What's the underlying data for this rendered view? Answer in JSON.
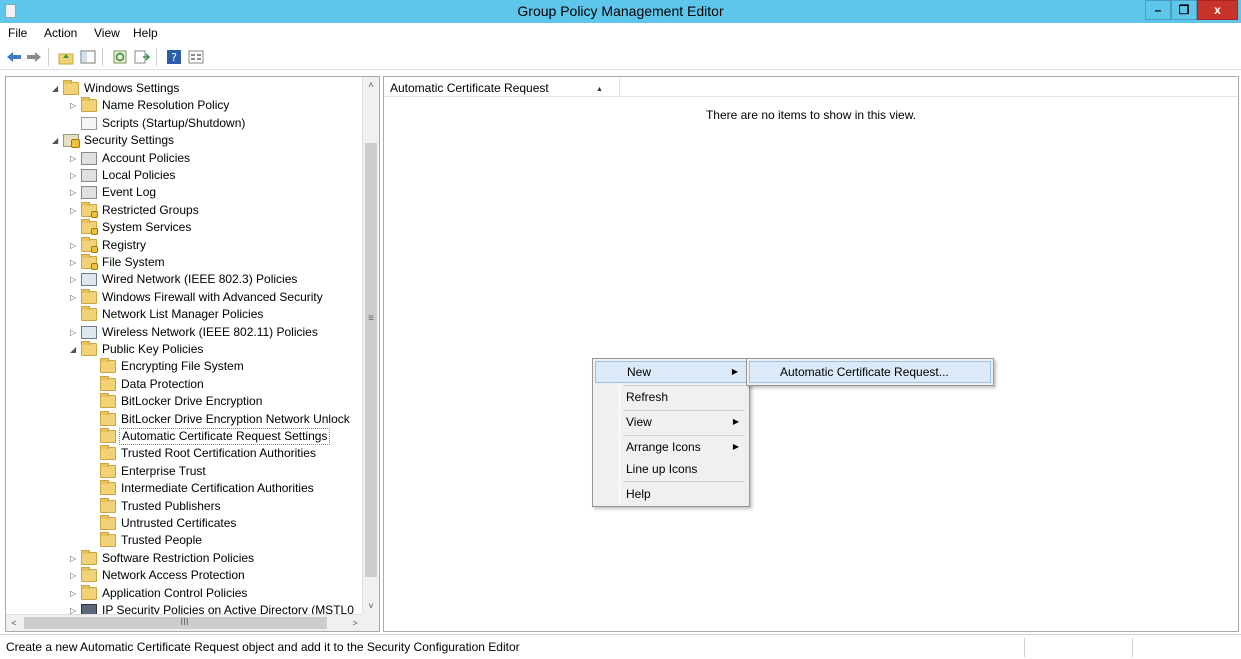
{
  "window": {
    "title": "Group Policy Management Editor",
    "min_glyph": "–",
    "max_glyph": "❐",
    "close_glyph": "x"
  },
  "menu": {
    "items": [
      "File",
      "Action",
      "View",
      "Help"
    ]
  },
  "colors": {
    "titlebar": "#5ec6eb",
    "close": "#c7352a",
    "highlight": "#dbe9f8",
    "folder": "#f2d277"
  },
  "tree": {
    "items": [
      {
        "label": "Windows Settings",
        "expander": "◢",
        "icon": "folder-icon"
      },
      {
        "label": "Name Resolution Policy",
        "expander": "▷",
        "icon": "folder-icon"
      },
      {
        "label": "Scripts (Startup/Shutdown)",
        "expander": "",
        "icon": "script-icon"
      },
      {
        "label": "Security Settings",
        "expander": "◢",
        "icon": "security-icon"
      },
      {
        "label": "Account Policies",
        "expander": "▷",
        "icon": "policy-icon"
      },
      {
        "label": "Local Policies",
        "expander": "▷",
        "icon": "policy-icon"
      },
      {
        "label": "Event Log",
        "expander": "▷",
        "icon": "policy-icon"
      },
      {
        "label": "Restricted Groups",
        "expander": "▷",
        "icon": "secure-folder-icon"
      },
      {
        "label": "System Services",
        "expander": "",
        "icon": "secure-folder-icon"
      },
      {
        "label": "Registry",
        "expander": "▷",
        "icon": "secure-folder-icon"
      },
      {
        "label": "File System",
        "expander": "▷",
        "icon": "secure-folder-icon"
      },
      {
        "label": "Wired Network (IEEE 802.3) Policies",
        "expander": "▷",
        "icon": "wired-network-icon"
      },
      {
        "label": "Windows Firewall with Advanced Security",
        "expander": "▷",
        "icon": "folder-icon"
      },
      {
        "label": "Network List Manager Policies",
        "expander": "",
        "icon": "folder-icon"
      },
      {
        "label": "Wireless Network (IEEE 802.11) Policies",
        "expander": "▷",
        "icon": "wireless-network-icon"
      },
      {
        "label": "Public Key Policies",
        "expander": "◢",
        "icon": "folder-icon"
      },
      {
        "label": "Encrypting File System",
        "expander": "",
        "icon": "folder-icon"
      },
      {
        "label": "Data Protection",
        "expander": "",
        "icon": "folder-icon"
      },
      {
        "label": "BitLocker Drive Encryption",
        "expander": "",
        "icon": "folder-icon"
      },
      {
        "label": "BitLocker Drive Encryption Network Unlock",
        "expander": "",
        "icon": "folder-icon"
      },
      {
        "label": "Automatic Certificate Request Settings",
        "expander": "",
        "icon": "folder-icon",
        "selected": true
      },
      {
        "label": "Trusted Root Certification Authorities",
        "expander": "",
        "icon": "folder-icon"
      },
      {
        "label": "Enterprise Trust",
        "expander": "",
        "icon": "folder-icon"
      },
      {
        "label": "Intermediate Certification Authorities",
        "expander": "",
        "icon": "folder-icon"
      },
      {
        "label": "Trusted Publishers",
        "expander": "",
        "icon": "folder-icon"
      },
      {
        "label": "Untrusted Certificates",
        "expander": "",
        "icon": "folder-icon"
      },
      {
        "label": "Trusted People",
        "expander": "",
        "icon": "folder-icon"
      },
      {
        "label": "Software Restriction Policies",
        "expander": "▷",
        "icon": "folder-icon"
      },
      {
        "label": "Network Access Protection",
        "expander": "▷",
        "icon": "folder-icon"
      },
      {
        "label": "Application Control Policies",
        "expander": "▷",
        "icon": "folder-icon"
      },
      {
        "label": "IP Security Policies on Active Directory (MSTL0",
        "expander": "▷",
        "icon": "ipsec-icon"
      }
    ]
  },
  "list": {
    "column_header": "Automatic Certificate Request",
    "sort_glyph": "▲",
    "empty_message": "There are no items to show in this view."
  },
  "context_menu": {
    "new": "New",
    "refresh": "Refresh",
    "view": "View",
    "arrange_icons": "Arrange Icons",
    "line_up_icons": "Line up Icons",
    "help": "Help",
    "arrow_glyph": "▶"
  },
  "submenu": {
    "automatic_certificate_request": "Automatic Certificate Request..."
  },
  "scroll": {
    "up": "˄",
    "down": "˅",
    "left": "<",
    "right": ">",
    "vgrip": "≡",
    "hgrip": "III"
  },
  "status": {
    "text": "Create a new Automatic Certificate Request object and add it to the Security Configuration Editor"
  }
}
